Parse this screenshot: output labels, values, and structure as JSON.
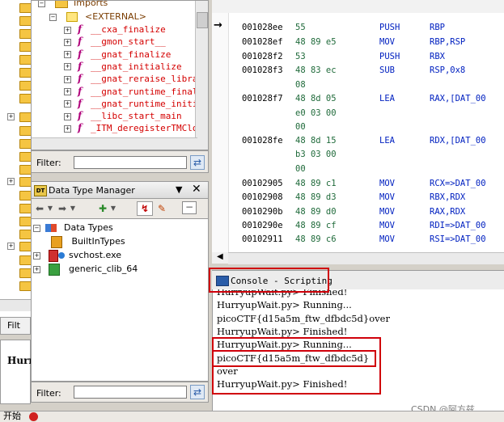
{
  "symbol_tree": {
    "imports_label": "Imports",
    "external_label": "<EXTERNAL>",
    "functions": [
      "__cxa_finalize",
      "__gmon_start__",
      "__gnat_finalize",
      "__gnat_initialize",
      "__gnat_reraise_librar",
      "__gnat_runtime_finali",
      "__gnat_runtime_initia",
      "__libc_start_main",
      "_ITM_deregisterTMClon"
    ],
    "function_icon_glyph": "f",
    "filter_label": "Filter:",
    "filter_value": ""
  },
  "left_strip": {
    "filter_tab_label": "Filt",
    "bottom_text": "Hurr"
  },
  "data_type_manager": {
    "title": "Data Type Manager",
    "title_badge": "DT",
    "root_label": "Data Types",
    "items": [
      "BuiltInTypes",
      "svchost.exe",
      "generic_clib_64"
    ],
    "filter_label": "Filter:",
    "filter_value": ""
  },
  "listing": {
    "rows": [
      {
        "addr": "001028ee",
        "bytes": "55",
        "mnem": "PUSH",
        "ops": "RBP"
      },
      {
        "addr": "001028ef",
        "bytes": "48 89 e5",
        "mnem": "MOV",
        "ops": "RBP,RSP"
      },
      {
        "addr": "001028f2",
        "bytes": "53",
        "mnem": "PUSH",
        "ops": "RBX"
      },
      {
        "addr": "001028f3",
        "bytes": "48 83 ec",
        "mnem": "SUB",
        "ops": "RSP,0x8"
      },
      {
        "addr": "",
        "bytes": "08",
        "mnem": "",
        "ops": ""
      },
      {
        "addr": "001028f7",
        "bytes": "48 8d 05",
        "mnem": "LEA",
        "ops": "RAX,[DAT_00"
      },
      {
        "addr": "",
        "bytes": "e0 03 00",
        "mnem": "",
        "ops": ""
      },
      {
        "addr": "",
        "bytes": "00",
        "mnem": "",
        "ops": ""
      },
      {
        "addr": "001028fe",
        "bytes": "48 8d 15",
        "mnem": "LEA",
        "ops": "RDX,[DAT_00"
      },
      {
        "addr": "",
        "bytes": "b3 03 00",
        "mnem": "",
        "ops": ""
      },
      {
        "addr": "",
        "bytes": "00",
        "mnem": "",
        "ops": ""
      },
      {
        "addr": "00102905",
        "bytes": "48 89 c1",
        "mnem": "MOV",
        "ops": "RCX=>DAT_00"
      },
      {
        "addr": "00102908",
        "bytes": "48 89 d3",
        "mnem": "MOV",
        "ops": "RBX,RDX"
      },
      {
        "addr": "0010290b",
        "bytes": "48 89 d0",
        "mnem": "MOV",
        "ops": "RAX,RDX"
      },
      {
        "addr": "0010290e",
        "bytes": "48 89 cf",
        "mnem": "MOV",
        "ops": "RDI=>DAT_00"
      },
      {
        "addr": "00102911",
        "bytes": "48 89 c6",
        "mnem": "MOV",
        "ops": "RSI=>DAT_00"
      }
    ],
    "cursor_arrow": "→"
  },
  "console": {
    "title": "Console - Scripting",
    "lines": [
      "HurryupWait.py> Finished!",
      "HurryupWait.py> Running...",
      "picoCTF{d15a5m_ftw_dfbdc5d}over",
      "HurryupWait.py> Finished!",
      "HurryupWait.py> Running...",
      "picoCTF{d15a5m_ftw_dfbdc5d}",
      " over",
      "HurryupWait.py> Finished!"
    ]
  },
  "taskbar": {
    "start_label": "开始"
  },
  "watermark": "CSDN @阿方兹",
  "colors": {
    "highlight_box": "#d0000a",
    "function_name": "#d40000",
    "mnemonic": "#0020c0",
    "bytes": "#1f6a3a"
  }
}
